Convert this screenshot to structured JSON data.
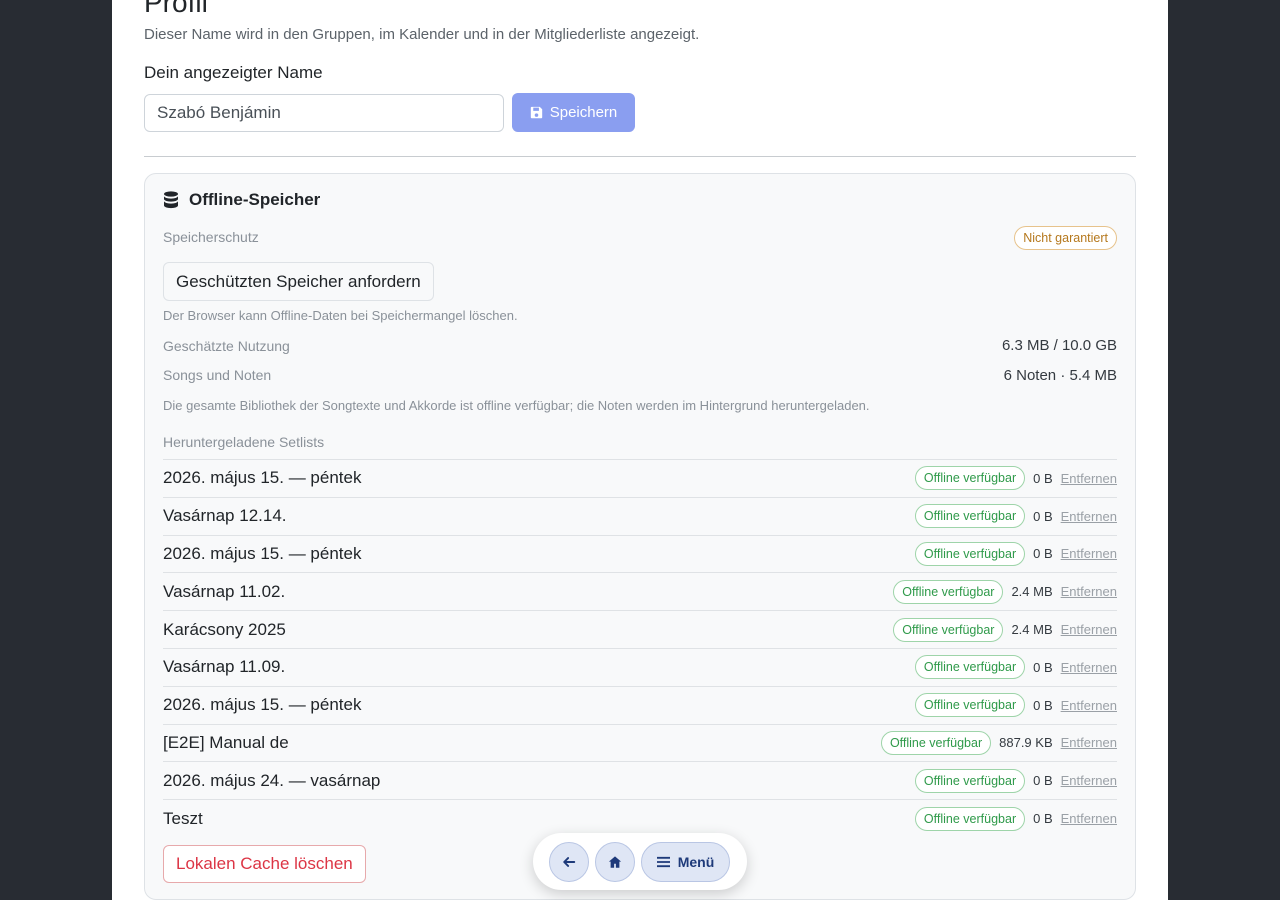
{
  "profile": {
    "title": "Profil",
    "description": "Dieser Name wird in den Gruppen, im Kalender und in der Mitgliederliste angezeigt.",
    "name_label": "Dein angezeigter Name",
    "name_value": "Szabó Benjámin",
    "save_label": "Speichern"
  },
  "offline": {
    "heading": "Offline-Speicher",
    "protection_label": "Speicherschutz",
    "protection_status": "Nicht garantiert",
    "request_button": "Geschützten Speicher anfordern",
    "protection_note": "Der Browser kann Offline-Daten bei Speichermangel löschen.",
    "usage_label": "Geschätzte Nutzung",
    "usage_value": "6.3 MB / 10.0 GB",
    "songs_label": "Songs und Noten",
    "songs_value": "6 Noten · 5.4 MB",
    "library_note": "Die gesamte Bibliothek der Songtexte und Akkorde ist offline verfügbar; die Noten werden im Hintergrund heruntergeladen.",
    "setlists_label": "Heruntergeladene Setlists",
    "status_label": "Offline verfügbar",
    "remove_label": "Entfernen",
    "setlists": [
      {
        "name": "2026. május 15. — péntek",
        "size": "0 B"
      },
      {
        "name": "Vasárnap 12.14.",
        "size": "0 B"
      },
      {
        "name": "2026. május 15. — péntek",
        "size": "0 B"
      },
      {
        "name": "Vasárnap 11.02.",
        "size": "2.4 MB"
      },
      {
        "name": "Karácsony 2025",
        "size": "2.4 MB"
      },
      {
        "name": "Vasárnap 11.09.",
        "size": "0 B"
      },
      {
        "name": "2026. május 15. — péntek",
        "size": "0 B"
      },
      {
        "name": "[E2E] Manual de",
        "size": "887.9 KB"
      },
      {
        "name": "2026. május 24. — vasárnap",
        "size": "0 B"
      },
      {
        "name": "Teszt",
        "size": "0 B"
      }
    ],
    "clear_button": "Lokalen Cache löschen"
  },
  "nav": {
    "back_icon": "arrow-left-icon",
    "home_icon": "home-icon",
    "menu_icon": "hamburger-icon",
    "menu_label": "Menü"
  }
}
